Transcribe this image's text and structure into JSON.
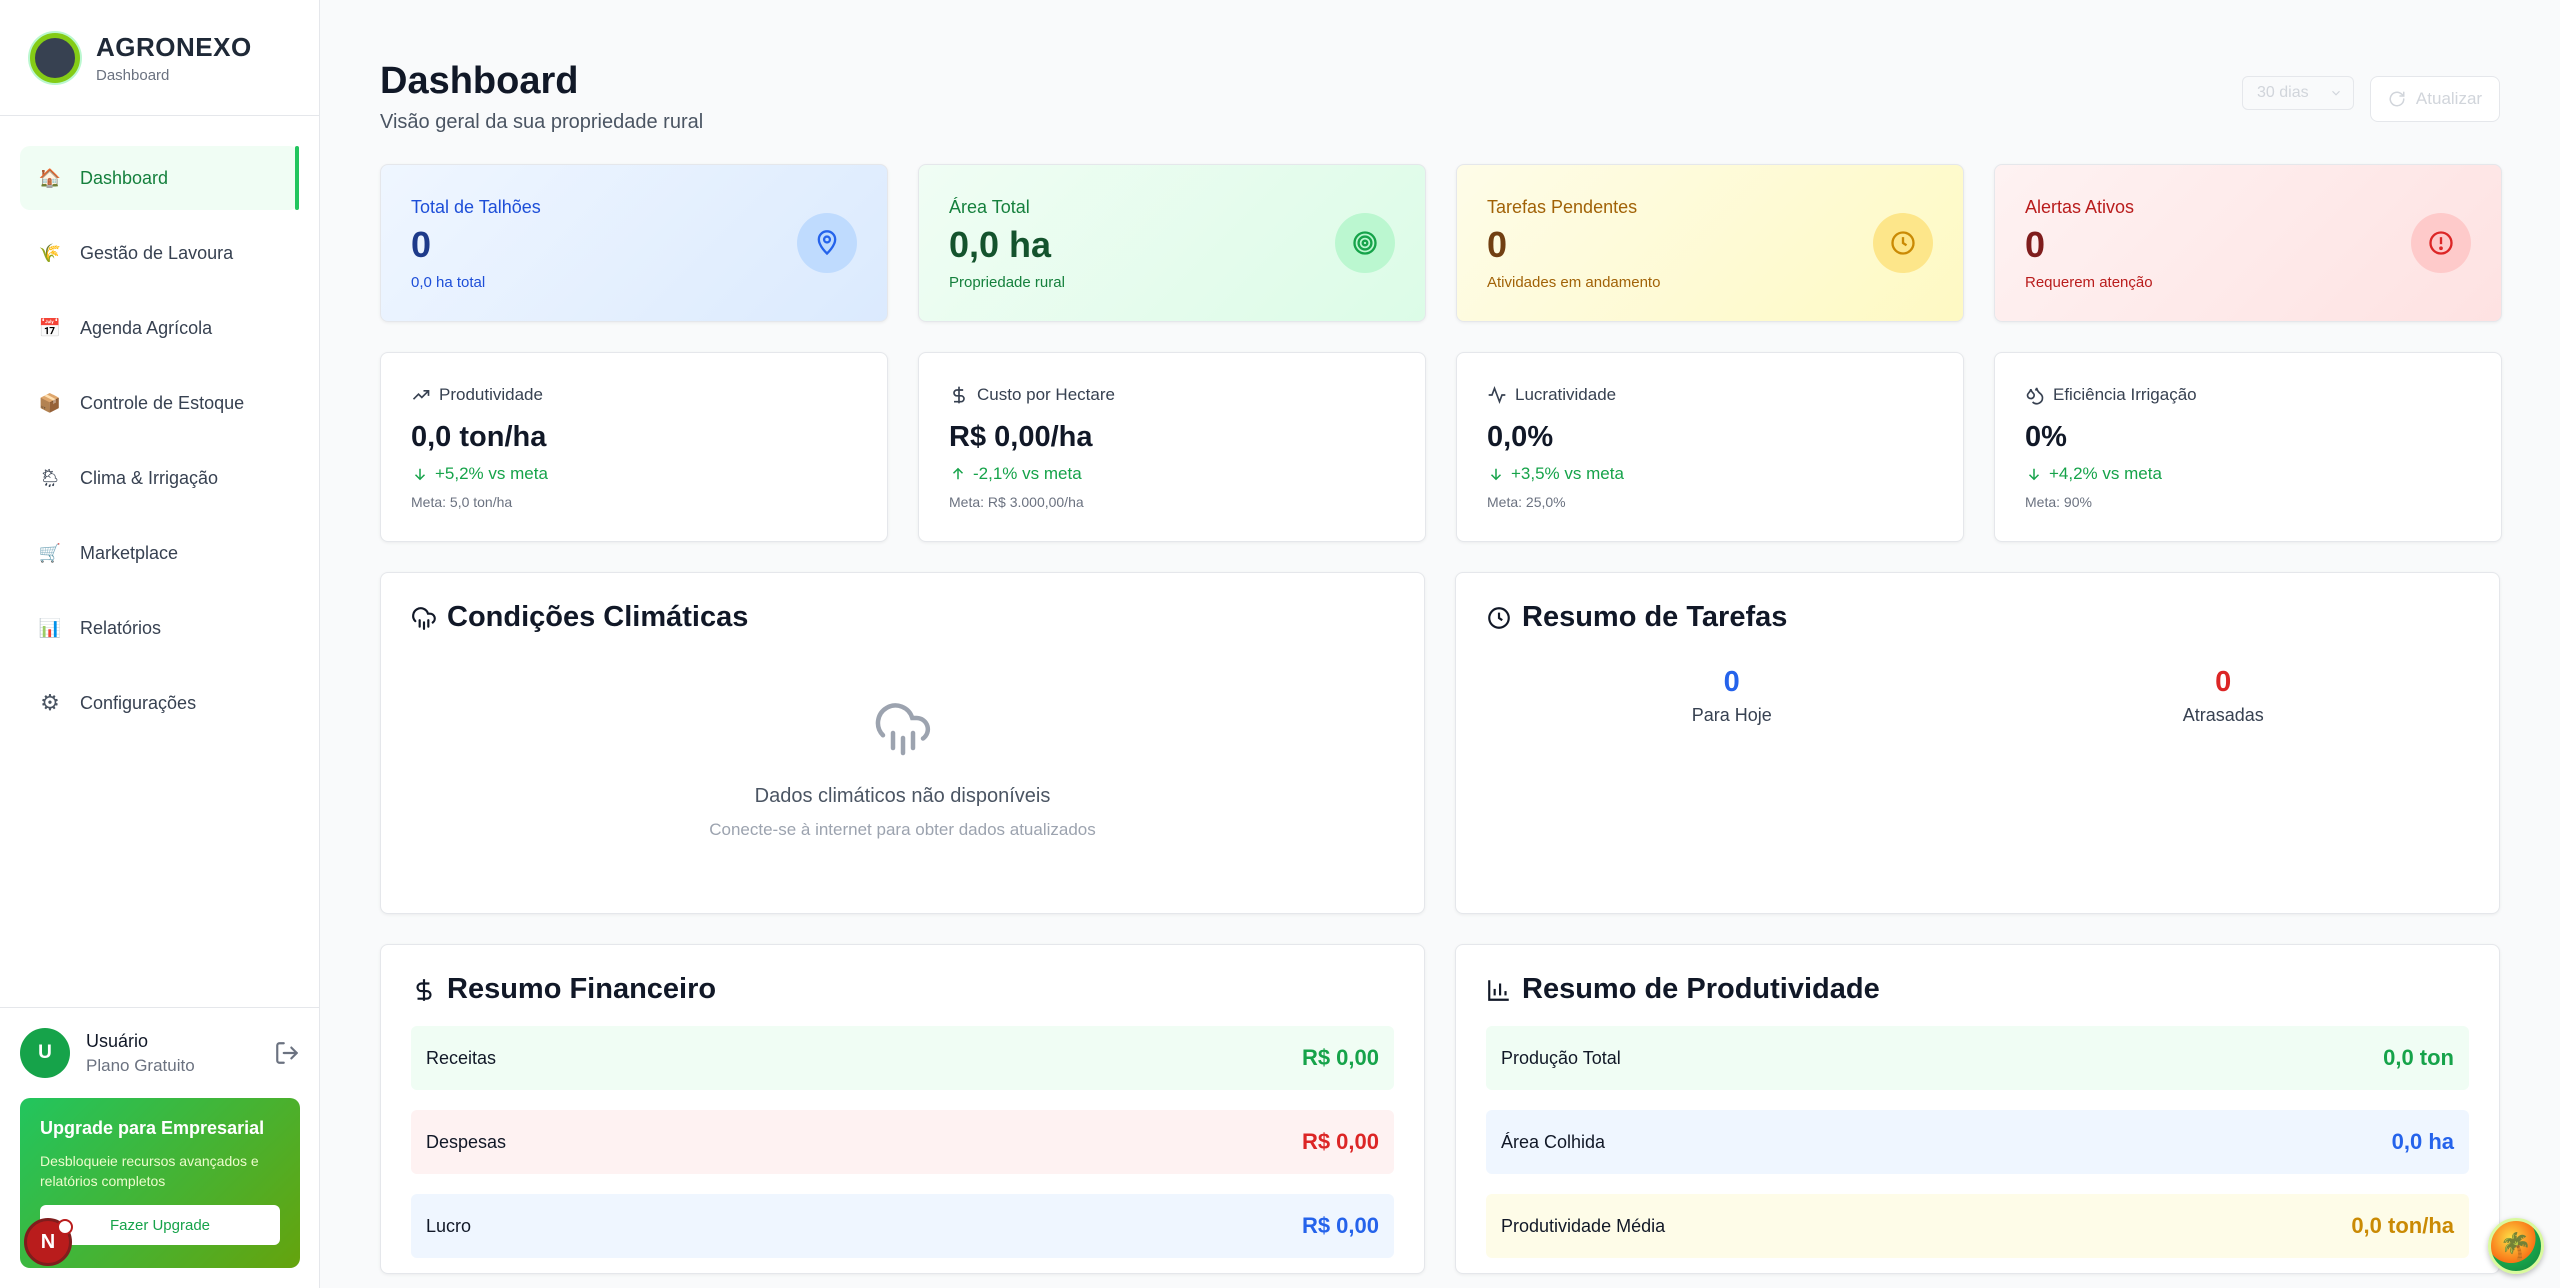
{
  "brand": {
    "name": "AGRONEXO",
    "subtitle": "Dashboard"
  },
  "sidebar": {
    "items": [
      {
        "label": "Dashboard",
        "icon": "home-icon",
        "glyph": "🏠",
        "active": true
      },
      {
        "label": "Gestão de Lavoura",
        "icon": "crop-icon",
        "glyph": "🌾"
      },
      {
        "label": "Agenda Agrícola",
        "icon": "calendar-icon",
        "glyph": "📅"
      },
      {
        "label": "Controle de Estoque",
        "icon": "package-icon",
        "glyph": "📦"
      },
      {
        "label": "Clima & Irrigação",
        "icon": "weather-icon",
        "glyph": "🌦"
      },
      {
        "label": "Marketplace",
        "icon": "cart-icon",
        "glyph": "🛒"
      },
      {
        "label": "Relatórios",
        "icon": "chart-icon",
        "glyph": "📊"
      },
      {
        "label": "Configurações",
        "icon": "gear-icon",
        "glyph": "⚙"
      }
    ]
  },
  "user": {
    "initial": "U",
    "name": "Usuário",
    "plan": "Plano Gratuito"
  },
  "upgrade": {
    "title": "Upgrade para Empresarial",
    "text": "Desbloqueie recursos avançados e relatórios completos",
    "button": "Fazer Upgrade",
    "badge": "N"
  },
  "header": {
    "title": "Dashboard",
    "subtitle": "Visão geral da sua propriedade rural",
    "period": "30 dias",
    "refresh": "Atualizar"
  },
  "stats": [
    {
      "label": "Total de Talhões",
      "value": "0",
      "foot": "0,0 ha total",
      "icon": "map-pin-icon",
      "theme": "blue"
    },
    {
      "label": "Área Total",
      "value": "0,0 ha",
      "foot": "Propriedade rural",
      "icon": "target-icon",
      "theme": "green"
    },
    {
      "label": "Tarefas Pendentes",
      "value": "0",
      "foot": "Atividades em andamento",
      "icon": "clock-icon",
      "theme": "yellow"
    },
    {
      "label": "Alertas Ativos",
      "value": "0",
      "foot": "Requerem atenção",
      "icon": "alert-icon",
      "theme": "red"
    }
  ],
  "metrics": [
    {
      "label": "Produtividade",
      "value": "0,0 ton/ha",
      "delta": "+5,2% vs meta",
      "goal": "Meta: 5,0 ton/ha",
      "icon": "trending-up-icon",
      "arrow": "down"
    },
    {
      "label": "Custo por Hectare",
      "value": "R$ 0,00/ha",
      "delta": "-2,1% vs meta",
      "goal": "Meta: R$ 3.000,00/ha",
      "icon": "dollar-icon",
      "arrow": "up"
    },
    {
      "label": "Lucratividade",
      "value": "0,0%",
      "delta": "+3,5% vs meta",
      "goal": "Meta: 25,0%",
      "icon": "activity-icon",
      "arrow": "down"
    },
    {
      "label": "Eficiência Irrigação",
      "value": "0%",
      "delta": "+4,2% vs meta",
      "goal": "Meta: 90%",
      "icon": "droplets-icon",
      "arrow": "down"
    }
  ],
  "weather": {
    "title": "Condições Climáticas",
    "message": "Dados climáticos não disponíveis",
    "sub": "Conecte-se à internet para obter dados atualizados"
  },
  "tasks": {
    "title": "Resumo de Tarefas",
    "today_value": "0",
    "today_label": "Para Hoje",
    "late_value": "0",
    "late_label": "Atrasadas"
  },
  "finance": {
    "title": "Resumo Financeiro",
    "rows": [
      {
        "label": "Receitas",
        "value": "R$ 0,00"
      },
      {
        "label": "Despesas",
        "value": "R$ 0,00"
      },
      {
        "label": "Lucro",
        "value": "R$ 0,00"
      }
    ]
  },
  "productivity": {
    "title": "Resumo de Produtividade",
    "rows": [
      {
        "label": "Produção Total",
        "value": "0,0 ton"
      },
      {
        "label": "Área Colhida",
        "value": "0,0 ha"
      },
      {
        "label": "Produtividade Média",
        "value": "0,0 ton/ha"
      }
    ]
  },
  "colors": {
    "accent": "#22c55e",
    "brand": "#16a34a"
  }
}
